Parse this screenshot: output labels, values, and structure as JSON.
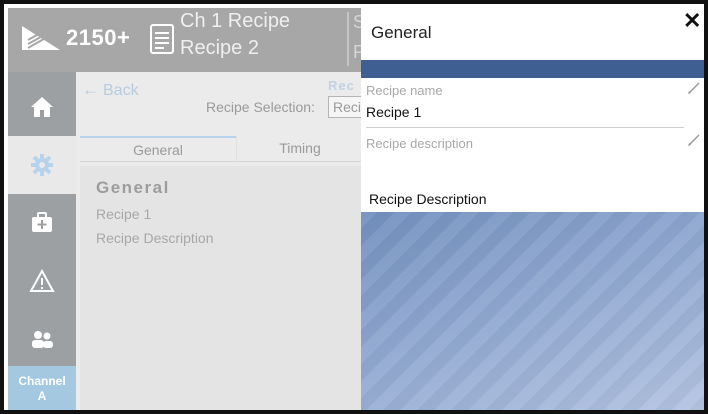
{
  "header": {
    "model": "2150+",
    "channel_line1": "Ch 1 Recipe",
    "channel_line2": "Recipe 2",
    "extra_line1": "S",
    "extra_line2": "F"
  },
  "sidenav": {
    "items": [
      {
        "icon": "home-icon"
      },
      {
        "icon": "gear-icon"
      },
      {
        "icon": "medical-kit-icon"
      },
      {
        "icon": "warning-icon"
      },
      {
        "icon": "users-icon"
      }
    ],
    "channel_line1": "Channel",
    "channel_line2": "A"
  },
  "content": {
    "back_label": "Back",
    "recipe_fragment": "Rec",
    "recipe_selection_label": "Recipe Selection:",
    "recipe_selection_value": "Reci",
    "tabs": [
      {
        "label": "General"
      },
      {
        "label": "Timing"
      }
    ],
    "panel": {
      "title": "General",
      "recipe_name": "Recipe 1",
      "recipe_description": "Recipe Description"
    }
  },
  "overlay": {
    "title": "General",
    "close_symbol": "✕",
    "fields": [
      {
        "label": "Recipe name",
        "value": "Recipe 1"
      },
      {
        "label": "Recipe description",
        "value": "Recipe Description"
      }
    ]
  },
  "colors": {
    "topbar": "#a7a7a7",
    "sidenav": "#9da0a3",
    "channel": "#a3c8e0",
    "overlay_band": "#3f5f93"
  }
}
